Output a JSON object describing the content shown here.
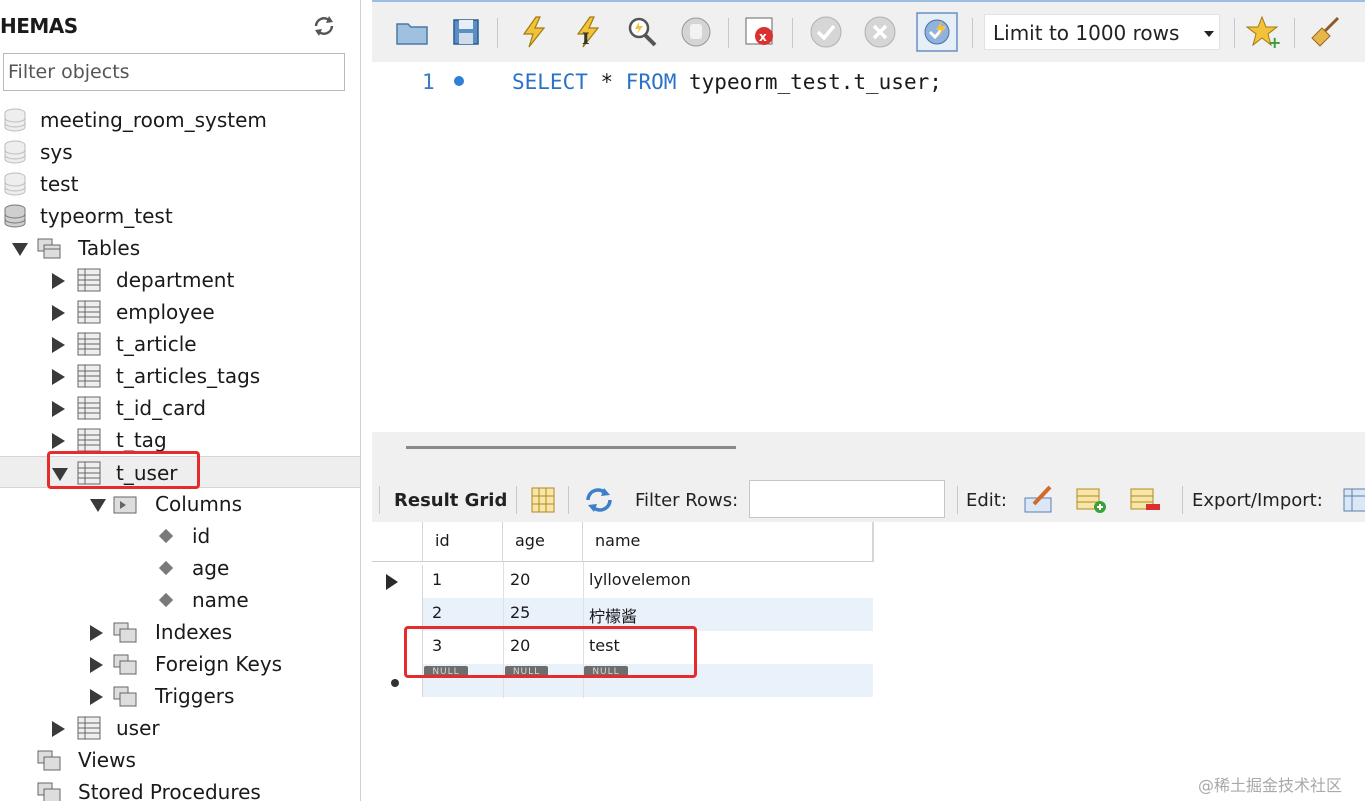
{
  "sidebar": {
    "title": "HEMAS",
    "filter_placeholder": "Filter objects",
    "schemas": [
      "meeting_room_system",
      "sys",
      "test",
      "typeorm_test"
    ],
    "tables_label": "Tables",
    "tables": [
      "department",
      "employee",
      "t_article",
      "t_articles_tags",
      "t_id_card",
      "t_tag",
      "t_user"
    ],
    "columns_label": "Columns",
    "columns": [
      "id",
      "age",
      "name"
    ],
    "indexes_label": "Indexes",
    "foreign_keys_label": "Foreign Keys",
    "triggers_label": "Triggers",
    "user_table": "user",
    "views_label": "Views",
    "stored_procedures_label": "Stored Procedures"
  },
  "toolbar": {
    "limit_label": "Limit to 1000 rows"
  },
  "editor": {
    "line_number": "1",
    "sql": {
      "k1": "SELECT",
      "t1": " * ",
      "k2": "FROM",
      "t2": " typeorm_test.t_user;"
    }
  },
  "result_toolbar": {
    "result_grid_label": "Result Grid",
    "filter_rows_label": "Filter Rows:",
    "edit_label": "Edit:",
    "export_label": "Export/Import:"
  },
  "grid": {
    "headers": [
      "id",
      "age",
      "name"
    ],
    "rows": [
      [
        "1",
        "20",
        "lyllovelemon"
      ],
      [
        "2",
        "25",
        "柠檬酱"
      ],
      [
        "3",
        "20",
        "test"
      ]
    ],
    "null_label": "NULL"
  },
  "watermark": "@稀土掘金技术社区",
  "colors": {
    "keyword": "#2a72c8",
    "highlight_box": "#e52b2b",
    "alt_row": "#e9f1fb"
  }
}
